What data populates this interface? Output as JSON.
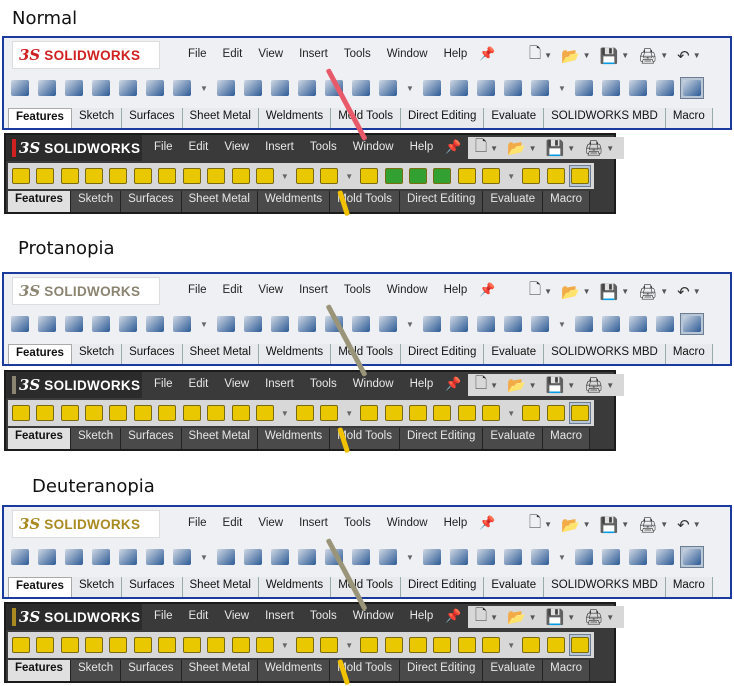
{
  "titles": {
    "normal": "Normal",
    "protanopia": "Protanopia",
    "deuteranopia": "Deuteranopia"
  },
  "logo": {
    "mark": "3S",
    "text": "SOLIDWORKS"
  },
  "menus": [
    "File",
    "Edit",
    "View",
    "Insert",
    "Tools",
    "Window",
    "Help"
  ],
  "tabs_new": [
    "Features",
    "Sketch",
    "Surfaces",
    "Sheet Metal",
    "Weldments",
    "Mold Tools",
    "Direct Editing",
    "Evaluate",
    "SOLIDWORKS MBD",
    "Macro"
  ],
  "tabs_old": [
    "Features",
    "Sketch",
    "Surfaces",
    "Sheet Metal",
    "Weldments",
    "Mold Tools",
    "Direct Editing",
    "Evaluate",
    "Macro"
  ],
  "icons": {
    "new_right": [
      "new-document-icon",
      "open-folder-icon",
      "save-icon",
      "print-icon",
      "undo-icon"
    ],
    "old_right": [
      "new-document-icon",
      "open-folder-icon",
      "save-icon",
      "print-icon"
    ]
  },
  "colors": {
    "frame_new": "#1a3a9e",
    "logo_red_normal": "#d02020",
    "logo_gray_protan": "#8a8470",
    "logo_gold_deuter": "#a88a20",
    "icon_blue": "#1d4f8f",
    "icon_yellow": "#e9c800",
    "icon_green_normal": "#33a032",
    "pointer_normal": "#e85a6a",
    "pointer_cvd": "#9a9478",
    "pointer_yellow": "#f2c200"
  }
}
